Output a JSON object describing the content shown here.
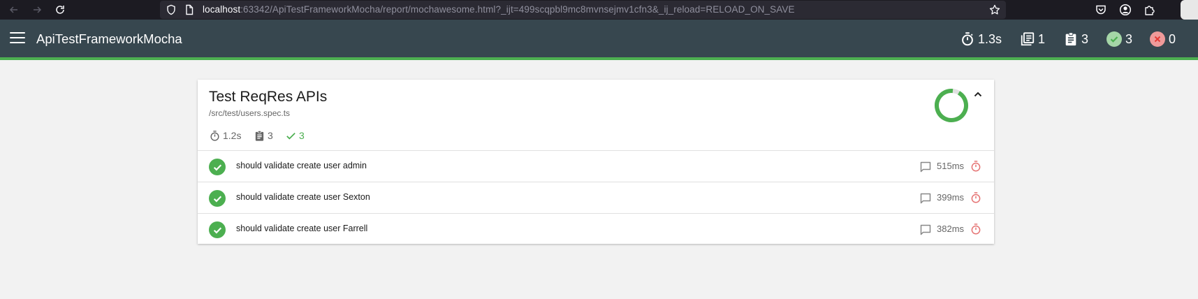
{
  "browser": {
    "url_host": "localhost",
    "url_rest": ":63342/ApiTestFrameworkMocha/report/mochawesome.html?_ijt=499scqpbl9mc8mvnsejmv1cfn3&_ij_reload=RELOAD_ON_SAVE"
  },
  "header": {
    "title": "ApiTestFrameworkMocha",
    "stats": {
      "duration": "1.3s",
      "suites": "1",
      "tests": "3",
      "passes": "3",
      "failures": "0"
    }
  },
  "suite": {
    "title": "Test ReqRes APIs",
    "file": "/src/test/users.spec.ts",
    "duration": "1.2s",
    "tests": "3",
    "passes": "3",
    "pass_fraction": 1.0,
    "tests_list": [
      {
        "title": "should validate create user admin",
        "duration": "515ms",
        "state": "passed"
      },
      {
        "title": "should validate create user Sexton",
        "duration": "399ms",
        "state": "passed"
      },
      {
        "title": "should validate create user Farrell",
        "duration": "382ms",
        "state": "passed"
      }
    ]
  },
  "colors": {
    "header_bg": "#37474f",
    "pass": "#4caf50",
    "fail": "#f44336",
    "timer_slow": "#e57373"
  },
  "icons": {
    "back": "arrow-left-icon",
    "forward": "arrow-right-icon",
    "reload": "reload-icon",
    "shield": "shield-icon",
    "page": "page-icon",
    "bookmark": "star-icon",
    "pocket": "pocket-icon",
    "account": "account-icon",
    "extensions": "puzzle-icon",
    "menu": "hamburger-icon",
    "timer": "timer-icon",
    "suites": "library-books-icon",
    "tests": "assignment-icon",
    "pass": "check-circle-icon",
    "fail": "cancel-circle-icon",
    "comment": "comment-icon",
    "collapse": "chevron-up-icon"
  }
}
